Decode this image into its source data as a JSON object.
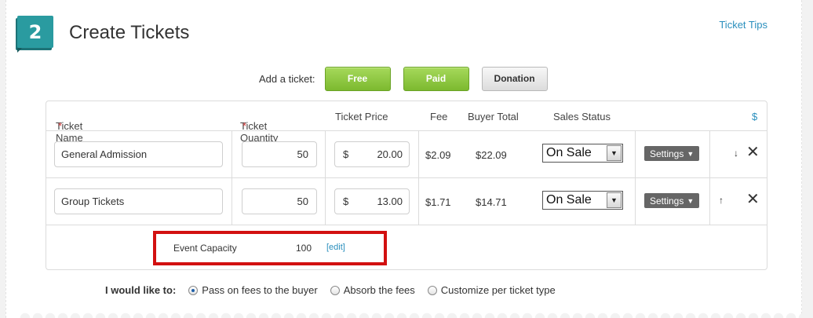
{
  "header": {
    "step_number": "2",
    "title": "Create Tickets",
    "tips_link": "Ticket Tips"
  },
  "add_ticket": {
    "label": "Add a ticket:",
    "free": "Free",
    "paid": "Paid",
    "donation": "Donation"
  },
  "table": {
    "headers": {
      "name": "Ticket Name",
      "quantity": "Ticket Quantity",
      "price": "Ticket Price",
      "fee": "Fee",
      "buyer_total": "Buyer Total",
      "sales_status": "Sales Status",
      "currency": "$",
      "required_mark": "*"
    },
    "rows": [
      {
        "name": "General Admission",
        "quantity": "50",
        "currency": "$",
        "price": "20.00",
        "fee": "$2.09",
        "buyer_total": "$22.09",
        "status": "On Sale",
        "settings": "Settings",
        "move_icon": "arrow-down-icon",
        "move_glyph": "↓"
      },
      {
        "name": "Group Tickets",
        "quantity": "50",
        "currency": "$",
        "price": "13.00",
        "fee": "$1.71",
        "buyer_total": "$14.71",
        "status": "On Sale",
        "settings": "Settings",
        "move_icon": "arrow-up-icon",
        "move_glyph": "↑"
      }
    ]
  },
  "capacity": {
    "label": "Event Capacity",
    "value": "100",
    "edit": "[edit]"
  },
  "fees": {
    "label": "I would like to:",
    "options": [
      {
        "label": "Pass on fees to the buyer",
        "selected": true
      },
      {
        "label": "Absorb the fees",
        "selected": false
      },
      {
        "label": "Customize per ticket type",
        "selected": false
      }
    ]
  },
  "colors": {
    "teal": "#2a9ba0",
    "green": "#7cb92f",
    "link": "#2a8fbd",
    "highlight": "#d21010"
  }
}
